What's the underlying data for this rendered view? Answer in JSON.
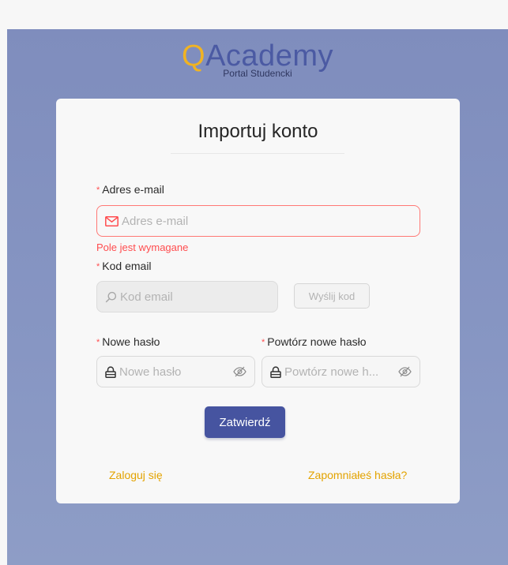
{
  "logo": {
    "title_q": "Q",
    "title_rest": "Academy",
    "subtitle": "Portal Studencki"
  },
  "colors": {
    "brand": "#4b5aa3",
    "accent": "#f0b323",
    "error": "#ff4d4f",
    "link": "#e3a300",
    "button": "#4654a0"
  },
  "form": {
    "title": "Importuj konto",
    "email": {
      "required_mark": "*",
      "label": "Adres e-mail",
      "placeholder": "Adres e-mail",
      "value": "",
      "icon": "mail-icon",
      "error": "Pole jest wymagane"
    },
    "code": {
      "required_mark": "*",
      "label": "Kod email",
      "placeholder": "Kod email",
      "value": "",
      "icon": "search-icon",
      "send_button": "Wyślij kod"
    },
    "new_password": {
      "required_mark": "*",
      "label": "Nowe hasło",
      "placeholder": "Nowe hasło",
      "icon": "lock-icon",
      "toggle_icon": "eye-off-icon"
    },
    "repeat_password": {
      "required_mark": "*",
      "label": "Powtórz nowe hasło",
      "placeholder": "Powtórz nowe h...",
      "icon": "lock-icon",
      "toggle_icon": "eye-off-icon"
    },
    "submit_label": "Zatwierdź"
  },
  "links": {
    "login": "Zaloguj się",
    "forgot": "Zapomniałeś hasła?"
  }
}
